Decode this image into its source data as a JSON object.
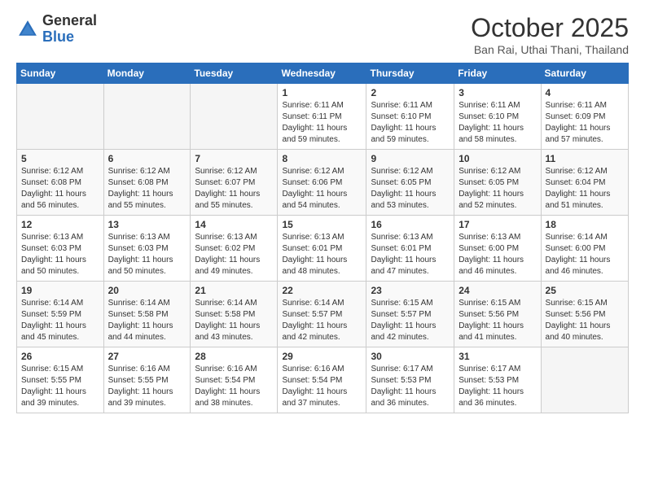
{
  "header": {
    "logo_general": "General",
    "logo_blue": "Blue",
    "month_title": "October 2025",
    "subtitle": "Ban Rai, Uthai Thani, Thailand"
  },
  "weekdays": [
    "Sunday",
    "Monday",
    "Tuesday",
    "Wednesday",
    "Thursday",
    "Friday",
    "Saturday"
  ],
  "weeks": [
    [
      {
        "day": "",
        "info": ""
      },
      {
        "day": "",
        "info": ""
      },
      {
        "day": "",
        "info": ""
      },
      {
        "day": "1",
        "info": "Sunrise: 6:11 AM\nSunset: 6:11 PM\nDaylight: 11 hours\nand 59 minutes."
      },
      {
        "day": "2",
        "info": "Sunrise: 6:11 AM\nSunset: 6:10 PM\nDaylight: 11 hours\nand 59 minutes."
      },
      {
        "day": "3",
        "info": "Sunrise: 6:11 AM\nSunset: 6:10 PM\nDaylight: 11 hours\nand 58 minutes."
      },
      {
        "day": "4",
        "info": "Sunrise: 6:11 AM\nSunset: 6:09 PM\nDaylight: 11 hours\nand 57 minutes."
      }
    ],
    [
      {
        "day": "5",
        "info": "Sunrise: 6:12 AM\nSunset: 6:08 PM\nDaylight: 11 hours\nand 56 minutes."
      },
      {
        "day": "6",
        "info": "Sunrise: 6:12 AM\nSunset: 6:08 PM\nDaylight: 11 hours\nand 55 minutes."
      },
      {
        "day": "7",
        "info": "Sunrise: 6:12 AM\nSunset: 6:07 PM\nDaylight: 11 hours\nand 55 minutes."
      },
      {
        "day": "8",
        "info": "Sunrise: 6:12 AM\nSunset: 6:06 PM\nDaylight: 11 hours\nand 54 minutes."
      },
      {
        "day": "9",
        "info": "Sunrise: 6:12 AM\nSunset: 6:05 PM\nDaylight: 11 hours\nand 53 minutes."
      },
      {
        "day": "10",
        "info": "Sunrise: 6:12 AM\nSunset: 6:05 PM\nDaylight: 11 hours\nand 52 minutes."
      },
      {
        "day": "11",
        "info": "Sunrise: 6:12 AM\nSunset: 6:04 PM\nDaylight: 11 hours\nand 51 minutes."
      }
    ],
    [
      {
        "day": "12",
        "info": "Sunrise: 6:13 AM\nSunset: 6:03 PM\nDaylight: 11 hours\nand 50 minutes."
      },
      {
        "day": "13",
        "info": "Sunrise: 6:13 AM\nSunset: 6:03 PM\nDaylight: 11 hours\nand 50 minutes."
      },
      {
        "day": "14",
        "info": "Sunrise: 6:13 AM\nSunset: 6:02 PM\nDaylight: 11 hours\nand 49 minutes."
      },
      {
        "day": "15",
        "info": "Sunrise: 6:13 AM\nSunset: 6:01 PM\nDaylight: 11 hours\nand 48 minutes."
      },
      {
        "day": "16",
        "info": "Sunrise: 6:13 AM\nSunset: 6:01 PM\nDaylight: 11 hours\nand 47 minutes."
      },
      {
        "day": "17",
        "info": "Sunrise: 6:13 AM\nSunset: 6:00 PM\nDaylight: 11 hours\nand 46 minutes."
      },
      {
        "day": "18",
        "info": "Sunrise: 6:14 AM\nSunset: 6:00 PM\nDaylight: 11 hours\nand 46 minutes."
      }
    ],
    [
      {
        "day": "19",
        "info": "Sunrise: 6:14 AM\nSunset: 5:59 PM\nDaylight: 11 hours\nand 45 minutes."
      },
      {
        "day": "20",
        "info": "Sunrise: 6:14 AM\nSunset: 5:58 PM\nDaylight: 11 hours\nand 44 minutes."
      },
      {
        "day": "21",
        "info": "Sunrise: 6:14 AM\nSunset: 5:58 PM\nDaylight: 11 hours\nand 43 minutes."
      },
      {
        "day": "22",
        "info": "Sunrise: 6:14 AM\nSunset: 5:57 PM\nDaylight: 11 hours\nand 42 minutes."
      },
      {
        "day": "23",
        "info": "Sunrise: 6:15 AM\nSunset: 5:57 PM\nDaylight: 11 hours\nand 42 minutes."
      },
      {
        "day": "24",
        "info": "Sunrise: 6:15 AM\nSunset: 5:56 PM\nDaylight: 11 hours\nand 41 minutes."
      },
      {
        "day": "25",
        "info": "Sunrise: 6:15 AM\nSunset: 5:56 PM\nDaylight: 11 hours\nand 40 minutes."
      }
    ],
    [
      {
        "day": "26",
        "info": "Sunrise: 6:15 AM\nSunset: 5:55 PM\nDaylight: 11 hours\nand 39 minutes."
      },
      {
        "day": "27",
        "info": "Sunrise: 6:16 AM\nSunset: 5:55 PM\nDaylight: 11 hours\nand 39 minutes."
      },
      {
        "day": "28",
        "info": "Sunrise: 6:16 AM\nSunset: 5:54 PM\nDaylight: 11 hours\nand 38 minutes."
      },
      {
        "day": "29",
        "info": "Sunrise: 6:16 AM\nSunset: 5:54 PM\nDaylight: 11 hours\nand 37 minutes."
      },
      {
        "day": "30",
        "info": "Sunrise: 6:17 AM\nSunset: 5:53 PM\nDaylight: 11 hours\nand 36 minutes."
      },
      {
        "day": "31",
        "info": "Sunrise: 6:17 AM\nSunset: 5:53 PM\nDaylight: 11 hours\nand 36 minutes."
      },
      {
        "day": "",
        "info": ""
      }
    ]
  ]
}
